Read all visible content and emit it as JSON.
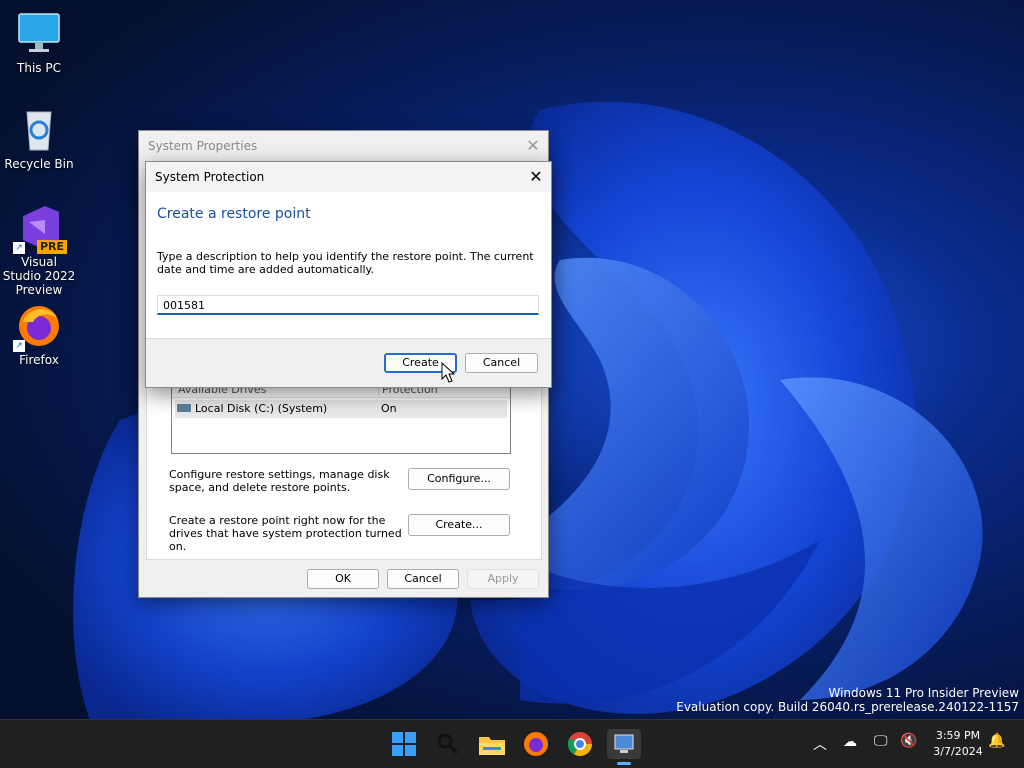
{
  "desktop": {
    "icons": [
      {
        "label": "This PC"
      },
      {
        "label": "Recycle Bin"
      },
      {
        "label": "Visual Studio 2022 Preview",
        "badge": "PRE"
      },
      {
        "label": "Firefox"
      }
    ],
    "watermark": {
      "line1": "Windows 11 Pro Insider Preview",
      "line2": "Evaluation copy. Build 26040.rs_prerelease.240122-1157"
    }
  },
  "system_properties": {
    "title": "System Properties",
    "drives_header": [
      "Available Drives",
      "Protection"
    ],
    "drive_row": {
      "name": "Local Disk (C:) (System)",
      "protection": "On"
    },
    "configure_text": "Configure restore settings, manage disk space, and delete restore points.",
    "configure_button": "Configure...",
    "create_text": "Create a restore point right now for the drives that have system protection turned on.",
    "create_button": "Create...",
    "ok": "OK",
    "cancel": "Cancel",
    "apply": "Apply"
  },
  "system_protection": {
    "title": "System Protection",
    "heading": "Create a restore point",
    "description": "Type a description to help you identify the restore point. The current date and time are added automatically.",
    "input_value": "001581",
    "create": "Create",
    "cancel": "Cancel",
    "accent": "#1a4f9c"
  },
  "taskbar": {
    "time": "3:59 PM",
    "date": "3/7/2024"
  }
}
